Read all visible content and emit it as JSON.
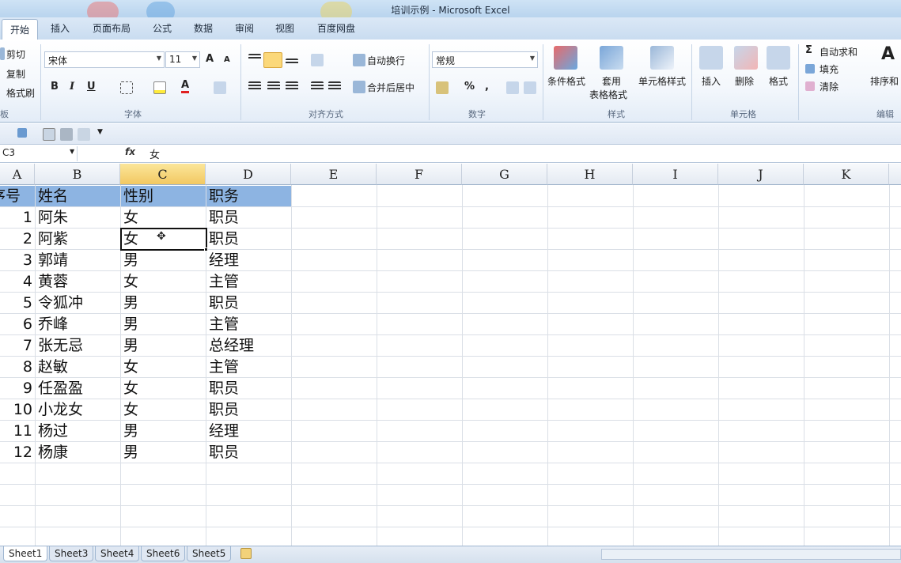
{
  "window": {
    "title": "培训示例 - Microsoft Excel"
  },
  "tabs": [
    "开始",
    "插入",
    "页面布局",
    "公式",
    "数据",
    "审阅",
    "视图",
    "百度网盘"
  ],
  "ribbon": {
    "clipboard": {
      "cut": "剪切",
      "copy": "复制",
      "format_painter": "格式刷",
      "group_label": "板"
    },
    "font": {
      "name": "宋体",
      "size": "11",
      "bold": "B",
      "italic": "I",
      "underline": "U",
      "group_label": "字体"
    },
    "alignment": {
      "wrap_text": "自动换行",
      "merge_center": "合并后居中",
      "group_label": "对齐方式"
    },
    "number": {
      "format": "常规",
      "percent": "%",
      "comma": ",",
      "group_label": "数字"
    },
    "styles": {
      "conditional": "条件格式",
      "table_line1": "套用",
      "table_line2": "表格格式",
      "cell_styles": "单元格样式",
      "group_label": "样式"
    },
    "cells": {
      "insert": "插入",
      "delete": "删除",
      "format": "格式",
      "group_label": "单元格"
    },
    "editing": {
      "autosum": "自动求和",
      "fill": "填充",
      "clear": "清除",
      "sort": "排序和",
      "group_label": "编辑"
    }
  },
  "formula_bar": {
    "name_box": "C3",
    "fx": "fx",
    "value": "女"
  },
  "columns": [
    "A",
    "B",
    "C",
    "D",
    "E",
    "F",
    "G",
    "H",
    "I",
    "J",
    "K"
  ],
  "table": {
    "header": {
      "id": "序号",
      "name": "姓名",
      "gender": "性别",
      "role": "职务"
    },
    "rows": [
      {
        "id": "1",
        "name": "阿朱",
        "gender": "女",
        "role": "职员"
      },
      {
        "id": "2",
        "name": "阿紫",
        "gender": "女",
        "role": "职员"
      },
      {
        "id": "3",
        "name": "郭靖",
        "gender": "男",
        "role": "经理"
      },
      {
        "id": "4",
        "name": "黄蓉",
        "gender": "女",
        "role": "主管"
      },
      {
        "id": "5",
        "name": "令狐冲",
        "gender": "男",
        "role": "职员"
      },
      {
        "id": "6",
        "name": "乔峰",
        "gender": "男",
        "role": "主管"
      },
      {
        "id": "7",
        "name": "张无忌",
        "gender": "男",
        "role": "总经理"
      },
      {
        "id": "8",
        "name": "赵敏",
        "gender": "女",
        "role": "主管"
      },
      {
        "id": "9",
        "name": "任盈盈",
        "gender": "女",
        "role": "职员"
      },
      {
        "id": "10",
        "name": "小龙女",
        "gender": "女",
        "role": "职员"
      },
      {
        "id": "11",
        "name": "杨过",
        "gender": "男",
        "role": "经理"
      },
      {
        "id": "12",
        "name": "杨康",
        "gender": "男",
        "role": "职员"
      }
    ]
  },
  "sheets": [
    "Sheet1",
    "Sheet3",
    "Sheet4",
    "Sheet6",
    "Sheet5"
  ],
  "colors": {
    "header_fill": "#8db4e2",
    "selected_col": "#f2c862"
  }
}
